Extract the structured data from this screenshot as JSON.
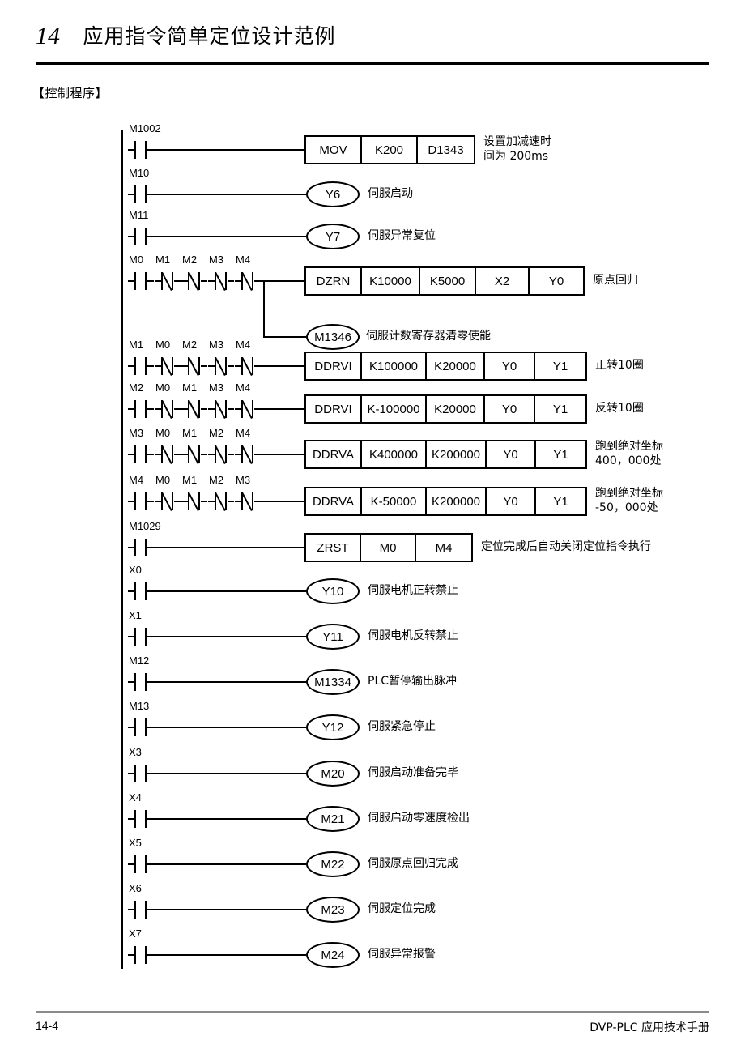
{
  "header": {
    "chapter_number": "14",
    "chapter_title": "应用指令简单定位设计范例"
  },
  "section_label": "【控制程序】",
  "footer": {
    "page_number": "14-4",
    "manual_title": "DVP-PLC 应用技术手册"
  },
  "ladder": {
    "rungs": [
      {
        "id": "rung-mov",
        "contacts": [
          {
            "label": "M1002",
            "type": "no"
          }
        ],
        "output": {
          "kind": "box",
          "cells": [
            "MOV",
            "K200",
            "D1343"
          ]
        },
        "comment": "设置加减速时\n间为 200ms"
      },
      {
        "id": "rung-y6",
        "contacts": [
          {
            "label": "M10",
            "type": "no"
          }
        ],
        "output": {
          "kind": "coil",
          "label": "Y6"
        },
        "comment": "伺服启动"
      },
      {
        "id": "rung-y7",
        "contacts": [
          {
            "label": "M11",
            "type": "no"
          }
        ],
        "output": {
          "kind": "coil",
          "label": "Y7"
        },
        "comment": "伺服异常复位"
      },
      {
        "id": "rung-dzrn",
        "contacts": [
          {
            "label": "M0",
            "type": "no"
          },
          {
            "label": "M1",
            "type": "nc"
          },
          {
            "label": "M2",
            "type": "nc"
          },
          {
            "label": "M3",
            "type": "nc"
          },
          {
            "label": "M4",
            "type": "nc"
          }
        ],
        "output": {
          "kind": "box",
          "cells": [
            "DZRN",
            "K10000",
            "K5000",
            "X2",
            "Y0"
          ]
        },
        "comment": "原点回归",
        "branch": {
          "kind": "coil",
          "label": "M1346",
          "comment": "伺服计数寄存器清零使能"
        }
      },
      {
        "id": "rung-ddrvi-fwd",
        "contacts": [
          {
            "label": "M1",
            "type": "no"
          },
          {
            "label": "M0",
            "type": "nc"
          },
          {
            "label": "M2",
            "type": "nc"
          },
          {
            "label": "M3",
            "type": "nc"
          },
          {
            "label": "M4",
            "type": "nc"
          }
        ],
        "output": {
          "kind": "box",
          "cells": [
            "DDRVI",
            "K100000",
            "K20000",
            "Y0",
            "Y1"
          ]
        },
        "comment": "正转10圈"
      },
      {
        "id": "rung-ddrvi-rev",
        "contacts": [
          {
            "label": "M2",
            "type": "no"
          },
          {
            "label": "M0",
            "type": "nc"
          },
          {
            "label": "M1",
            "type": "nc"
          },
          {
            "label": "M3",
            "type": "nc"
          },
          {
            "label": "M4",
            "type": "nc"
          }
        ],
        "output": {
          "kind": "box",
          "cells": [
            "DDRVI",
            "K-100000",
            "K20000",
            "Y0",
            "Y1"
          ]
        },
        "comment": "反转10圈"
      },
      {
        "id": "rung-ddrva-pos",
        "contacts": [
          {
            "label": "M3",
            "type": "no"
          },
          {
            "label": "M0",
            "type": "nc"
          },
          {
            "label": "M1",
            "type": "nc"
          },
          {
            "label": "M2",
            "type": "nc"
          },
          {
            "label": "M4",
            "type": "nc"
          }
        ],
        "output": {
          "kind": "box",
          "cells": [
            "DDRVA",
            "K400000",
            "K200000",
            "Y0",
            "Y1"
          ]
        },
        "comment": "跑到绝对坐标\n400，000处"
      },
      {
        "id": "rung-ddrva-neg",
        "contacts": [
          {
            "label": "M4",
            "type": "no"
          },
          {
            "label": "M0",
            "type": "nc"
          },
          {
            "label": "M1",
            "type": "nc"
          },
          {
            "label": "M2",
            "type": "nc"
          },
          {
            "label": "M3",
            "type": "nc"
          }
        ],
        "output": {
          "kind": "box",
          "cells": [
            "DDRVA",
            "K-50000",
            "K200000",
            "Y0",
            "Y1"
          ]
        },
        "comment": "跑到绝对坐标\n-50，000处"
      },
      {
        "id": "rung-zrst",
        "contacts": [
          {
            "label": "M1029",
            "type": "no"
          }
        ],
        "output": {
          "kind": "box",
          "cells": [
            "ZRST",
            "M0",
            "M4"
          ]
        },
        "comment": "定位完成后自动关闭定位指令执行"
      },
      {
        "id": "rung-y10",
        "contacts": [
          {
            "label": "X0",
            "type": "no"
          }
        ],
        "output": {
          "kind": "coil",
          "label": "Y10"
        },
        "comment": "伺服电机正转禁止"
      },
      {
        "id": "rung-y11",
        "contacts": [
          {
            "label": "X1",
            "type": "no"
          }
        ],
        "output": {
          "kind": "coil",
          "label": "Y11"
        },
        "comment": "伺服电机反转禁止"
      },
      {
        "id": "rung-m1334",
        "contacts": [
          {
            "label": "M12",
            "type": "no"
          }
        ],
        "output": {
          "kind": "coil",
          "label": "M1334"
        },
        "comment": "PLC暂停输出脉冲"
      },
      {
        "id": "rung-y12",
        "contacts": [
          {
            "label": "M13",
            "type": "no"
          }
        ],
        "output": {
          "kind": "coil",
          "label": "Y12"
        },
        "comment": "伺服紧急停止"
      },
      {
        "id": "rung-m20",
        "contacts": [
          {
            "label": "X3",
            "type": "no"
          }
        ],
        "output": {
          "kind": "coil",
          "label": "M20"
        },
        "comment": "伺服启动准备完毕"
      },
      {
        "id": "rung-m21",
        "contacts": [
          {
            "label": "X4",
            "type": "no"
          }
        ],
        "output": {
          "kind": "coil",
          "label": "M21"
        },
        "comment": "伺服启动零速度检出"
      },
      {
        "id": "rung-m22",
        "contacts": [
          {
            "label": "X5",
            "type": "no"
          }
        ],
        "output": {
          "kind": "coil",
          "label": "M22"
        },
        "comment": "伺服原点回归完成"
      },
      {
        "id": "rung-m23",
        "contacts": [
          {
            "label": "X6",
            "type": "no"
          }
        ],
        "output": {
          "kind": "coil",
          "label": "M23"
        },
        "comment": "伺服定位完成"
      },
      {
        "id": "rung-m24",
        "contacts": [
          {
            "label": "X7",
            "type": "no"
          }
        ],
        "output": {
          "kind": "coil",
          "label": "M24"
        },
        "comment": "伺服异常报警"
      }
    ]
  }
}
